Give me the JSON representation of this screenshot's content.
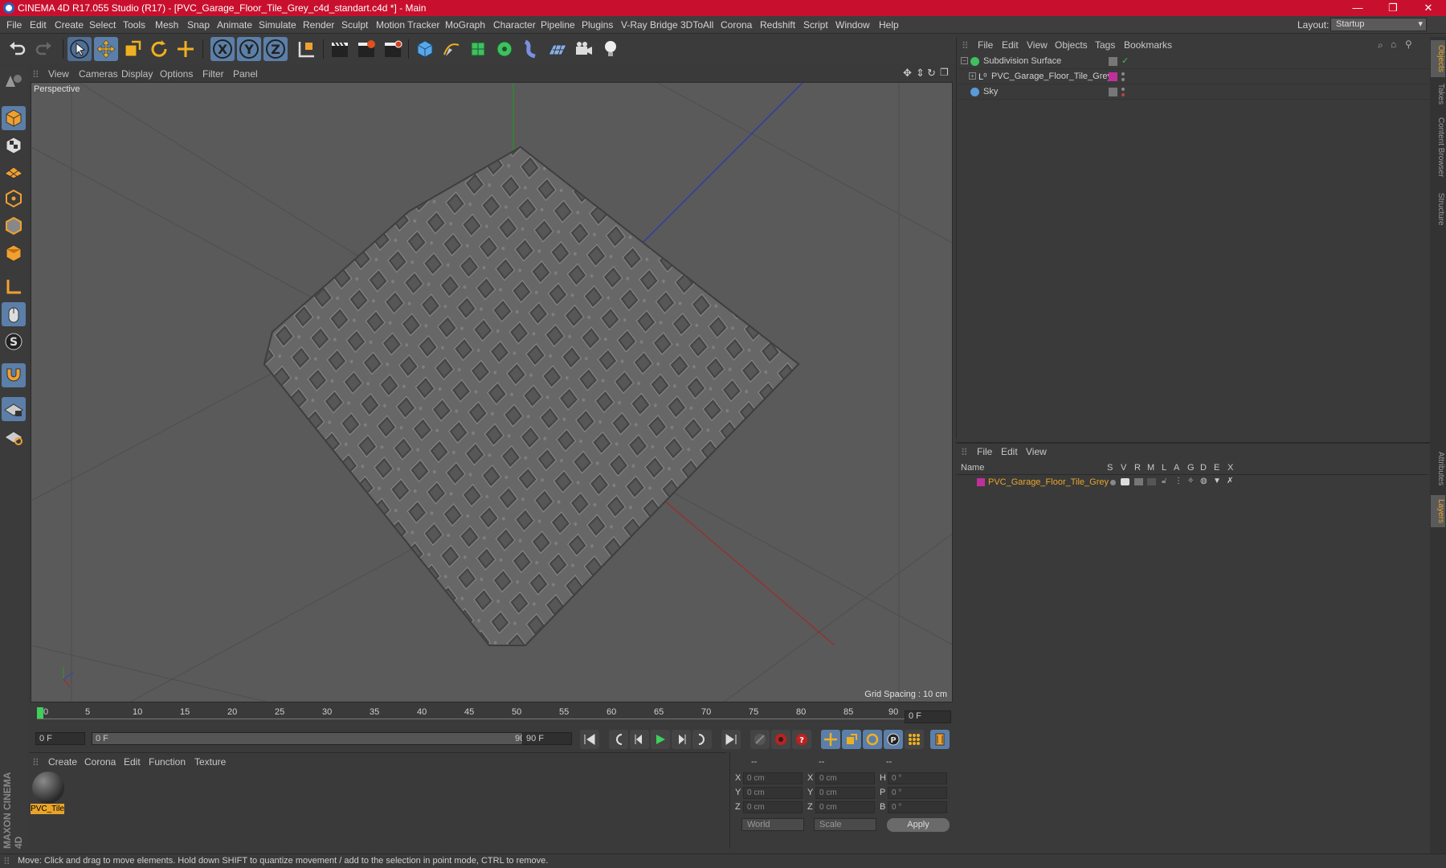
{
  "title_bar": {
    "title": "CINEMA 4D R17.055 Studio (R17) - [PVC_Garage_Floor_Tile_Grey_c4d_standart.c4d *] - Main",
    "minimize": "—",
    "restore": "❐",
    "close": "✕"
  },
  "menu": {
    "items": [
      "File",
      "Edit",
      "Create",
      "Select",
      "Tools",
      "Mesh",
      "Snap",
      "Animate",
      "Simulate",
      "Render",
      "Sculpt",
      "Motion Tracker",
      "MoGraph",
      "Character",
      "Pipeline",
      "Plugins",
      "V-Ray Bridge",
      "3DToAll",
      "Corona",
      "Redshift",
      "Script",
      "Window",
      "Help"
    ],
    "layout_label": "Layout:",
    "layout_value": "Startup"
  },
  "viewport": {
    "menu": [
      "View",
      "Cameras",
      "Display",
      "Options",
      "Filter",
      "Panel"
    ],
    "label": "Perspective",
    "grid_spacing": "Grid Spacing : 10 cm"
  },
  "timeline": {
    "ticks": [
      "0",
      "5",
      "10",
      "15",
      "20",
      "25",
      "30",
      "35",
      "40",
      "45",
      "50",
      "55",
      "60",
      "65",
      "70",
      "75",
      "80",
      "85",
      "90"
    ],
    "current_frame": "0 F"
  },
  "transport": {
    "start_field": "0 F",
    "range_start": "0 F",
    "range_end": "90 F",
    "end_field": "90 F"
  },
  "materials": {
    "menu": [
      "Create",
      "Corona",
      "Edit",
      "Function",
      "Texture"
    ],
    "items": [
      {
        "label": "PVC_Tile"
      }
    ]
  },
  "coordinates": {
    "headers": [
      "--",
      "--",
      "--"
    ],
    "rows": [
      {
        "a": "X",
        "av": "0 cm",
        "b": "X",
        "bv": "0 cm",
        "c": "H",
        "cv": "0 °"
      },
      {
        "a": "Y",
        "av": "0 cm",
        "b": "Y",
        "bv": "0 cm",
        "c": "P",
        "cv": "0 °"
      },
      {
        "a": "Z",
        "av": "0 cm",
        "b": "Z",
        "bv": "0 cm",
        "c": "B",
        "cv": "0 °"
      }
    ],
    "world": "World",
    "scale": "Scale",
    "apply": "Apply"
  },
  "objects_panel": {
    "menu": [
      "File",
      "Edit",
      "View",
      "Objects",
      "Tags",
      "Bookmarks"
    ],
    "items": [
      {
        "name": "Subdivision Surface"
      },
      {
        "name": "PVC_Garage_Floor_Tile_Grey"
      },
      {
        "name": "Sky"
      }
    ]
  },
  "layers_panel": {
    "menu": [
      "File",
      "Edit",
      "View"
    ],
    "columns": [
      "Name",
      "S",
      "V",
      "R",
      "M",
      "L",
      "A",
      "G",
      "D",
      "E",
      "X"
    ],
    "items": [
      {
        "name": "PVC_Garage_Floor_Tile_Grey"
      }
    ]
  },
  "right_tabs": [
    "Objects",
    "Takes",
    "Content Browser",
    "Structure",
    "Attributes",
    "Layers"
  ],
  "status": "Move: Click and drag to move elements. Hold down SHIFT to quantize movement / add to the selection in point mode, CTRL to remove.",
  "branding": "MAXON CINEMA 4D",
  "colors": {
    "title_bar": "#c8102e",
    "accent": "#5b7fa8",
    "highlight": "#e8a52a",
    "layer_color": "#c0309a"
  }
}
